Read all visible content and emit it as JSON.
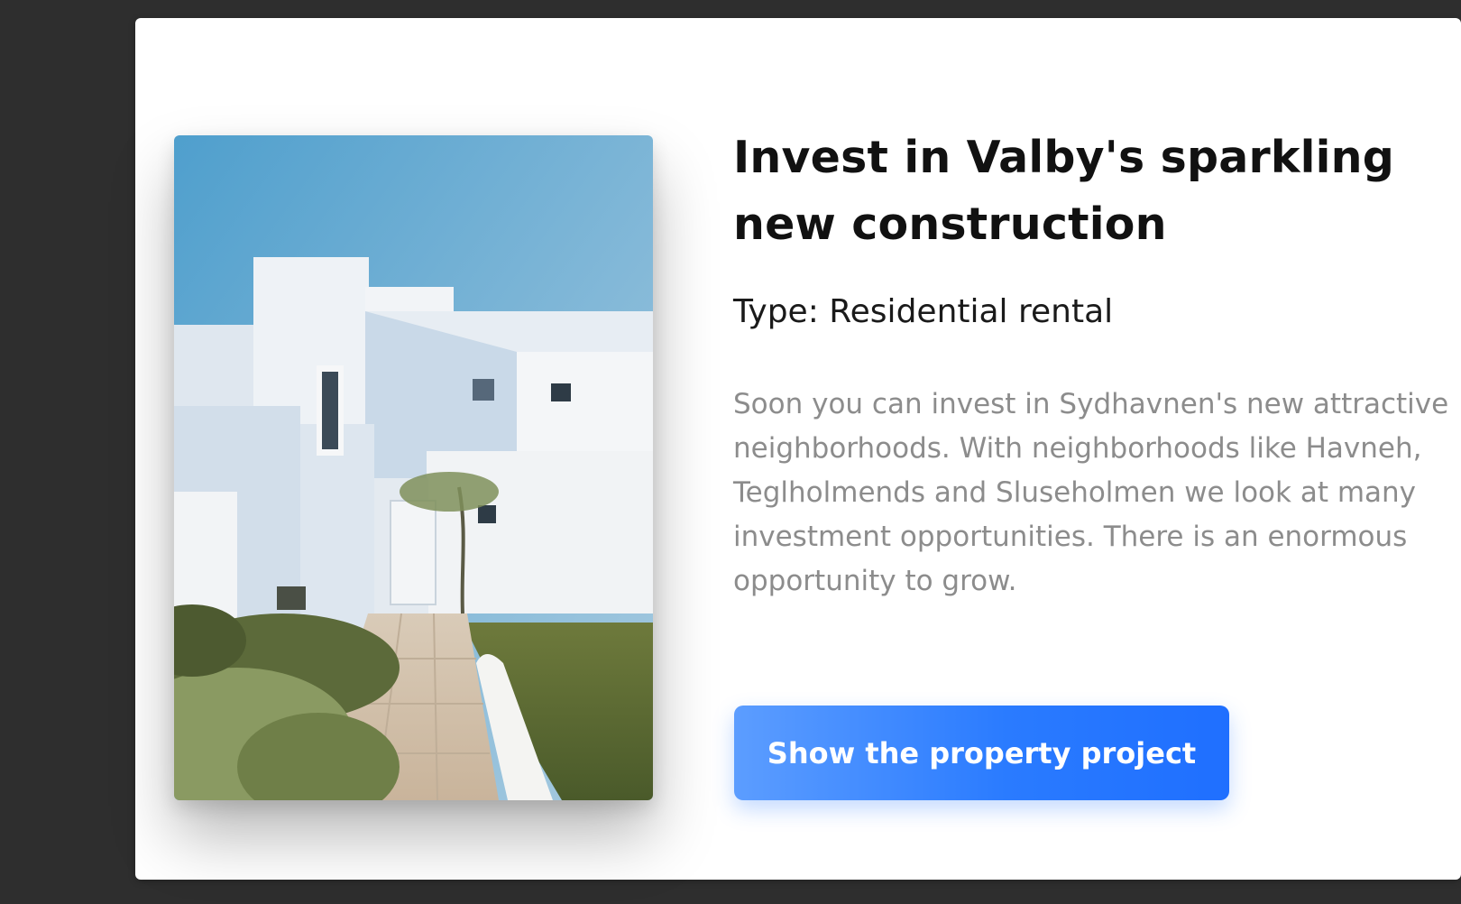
{
  "card": {
    "title": "Invest in Valby's sparkling new construction",
    "type_label": "Type: Residential rental",
    "description": "Soon you can invest in Sydhavnen's new attractive neighborhoods. With neighborhoods like Havneh, Teglholmends and Sluseholmen we look at many investment opportunities. There is an enormous opportunity to grow.",
    "cta_label": "Show the property project",
    "image": {
      "subject": "white modern house under blue sky with garden path"
    }
  },
  "colors": {
    "background": "#2e2e2e",
    "card": "#ffffff",
    "accent": "#2a7bff",
    "body_text": "#8c8c8c"
  }
}
